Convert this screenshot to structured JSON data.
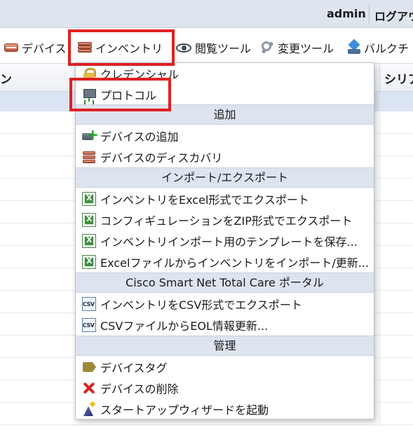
{
  "header": {
    "user": "admin",
    "logout_label": "ログアウ"
  },
  "toolbar": {
    "items": [
      {
        "label": "デバイス",
        "icon": "device-icon"
      },
      {
        "label": "インベントリ",
        "icon": "inventory-icon"
      },
      {
        "label": "閲覧ツール",
        "icon": "eye-icon"
      },
      {
        "label": "変更ツール",
        "icon": "wrench-icon"
      },
      {
        "label": "バルクチ",
        "icon": "bulk-icon"
      }
    ]
  },
  "table": {
    "left_column_header": "ン",
    "right_column_header": "シリア"
  },
  "menu": {
    "items_top": [
      {
        "label": "クレデンシャル",
        "icon": "lock-icon"
      },
      {
        "label": "プロトコル",
        "icon": "protocol-icon"
      }
    ],
    "section_add": "追加",
    "items_add": [
      {
        "label": "デバイスの追加",
        "icon": "add-device-icon"
      },
      {
        "label": "デバイスのディスカバリ",
        "icon": "discovery-icon"
      }
    ],
    "section_import_export": "インポート/エクスポート",
    "items_import_export": [
      {
        "label": "インベントリをExcel形式でエクスポート",
        "icon": "excel-icon"
      },
      {
        "label": "コンフィギュレーションをZIP形式でエクスポート",
        "icon": "excel-icon"
      },
      {
        "label": "インベントリインポート用のテンプレートを保存...",
        "icon": "excel-icon"
      },
      {
        "label": "Excelファイルからインベントリをインポート/更新...",
        "icon": "excel-icon"
      }
    ],
    "section_smartnet": "Cisco Smart Net Total Care ポータル",
    "items_smartnet": [
      {
        "label": "インベントリをCSV形式でエクスポート",
        "icon": "csv-icon"
      },
      {
        "label": "CSVファイルからEOL情報更新...",
        "icon": "csv-icon"
      }
    ],
    "section_manage": "管理",
    "items_manage": [
      {
        "label": "デバイスタグ",
        "icon": "tag-icon"
      },
      {
        "label": "デバイスの削除",
        "icon": "delete-icon"
      },
      {
        "label": "スタートアップウィザードを起動",
        "icon": "wizard-icon"
      }
    ]
  },
  "colors": {
    "highlight": "#e02020",
    "menu_section_bg": "#dde4ef",
    "topbar_bg": "#dfe5ef"
  }
}
